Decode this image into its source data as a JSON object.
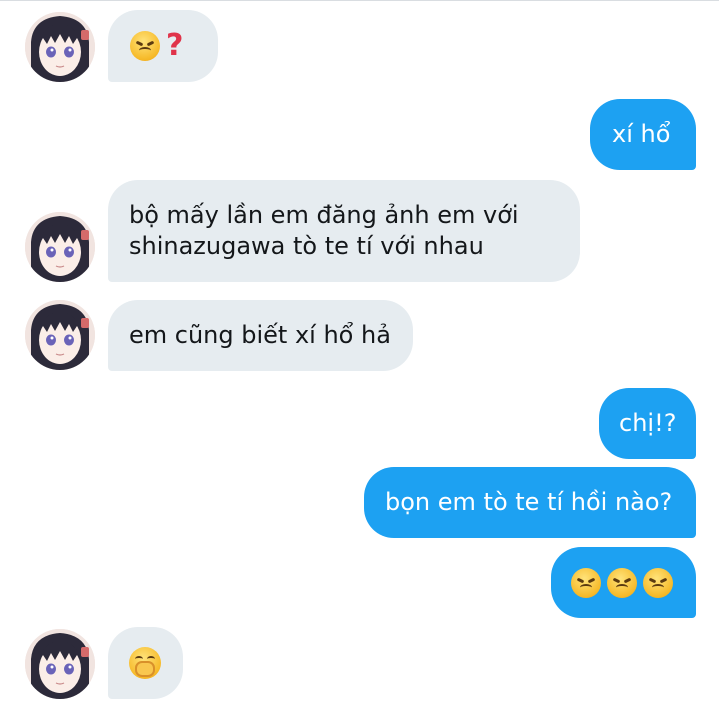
{
  "conversation": {
    "messages": [
      {
        "side": "in",
        "text": "",
        "emoji": [
          "angry-face",
          "red-question-mark"
        ]
      },
      {
        "side": "out",
        "text": "xí hổ"
      },
      {
        "side": "in",
        "lines": [
          "bộ mấy lần em đăng ảnh em với",
          "shinazugawa tò te tí với nhau"
        ]
      },
      {
        "side": "in",
        "text": "em cũng biết xí hổ hả"
      },
      {
        "side": "out",
        "text": "chị!?"
      },
      {
        "side": "out",
        "text": "bọn em tò te tí hồi nào?"
      },
      {
        "side": "out",
        "text": "",
        "emoji": [
          "angry-face",
          "angry-face",
          "angry-face"
        ]
      },
      {
        "side": "in",
        "text": "",
        "emoji": [
          "giggling-face-with-hand-over-mouth"
        ]
      }
    ]
  },
  "colors": {
    "incoming_bubble": "#e6ecf0",
    "outgoing_bubble": "#1da1f2",
    "outgoing_text": "#ffffff",
    "incoming_text": "#14171a"
  }
}
